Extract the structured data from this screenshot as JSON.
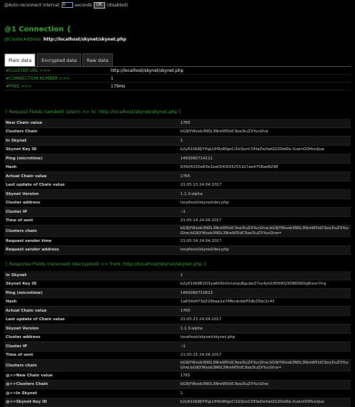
{
  "top": {
    "label": "@Auto-reconnect interval:",
    "interval_value": "0",
    "seconds": "seconds",
    "ok": "OK",
    "status": "(disabled)"
  },
  "connection": {
    "title": "@1 Connection {",
    "address_label": "@ClusterAddress:",
    "address": "http://localhost/skynet/skynet.php"
  },
  "tabs": [
    "Plain data",
    "Encrypted data",
    "Raw data"
  ],
  "summary": [
    {
      "k": "#CLUSTER URL >>>",
      "v": "http://localhost/skynet/skynet.php"
    },
    {
      "k": "#CONNECTION NUMBER >>>",
      "v": "1"
    },
    {
      "k": "#PING >>>",
      "v": "179ms"
    }
  ],
  "request": {
    "heading": "[ Request Fields (sended) (plain) >> to: http://localhost/skynet/skynet.php ]",
    "rows": [
      {
        "k": "New Chain value",
        "v": "1765"
      },
      {
        "k": "Clusters Chain",
        "v": "bG9jYWxob3N0L3NreW5ldC9za3luZXYucGhw"
      },
      {
        "k": "In Skynet",
        "v": "1"
      },
      {
        "k": "Skynet Key ID",
        "v": "b2y610b8JIYHgLUH0oRfgoCl1kQunCOHaZwXwGG2De6le.XuwnOOHunljua"
      },
      {
        "k": "Ping (microtime)",
        "v": "1493060714111"
      },
      {
        "k": "Hash",
        "v": "83904150a83e1ba0543f242551b7ae4758ae8298"
      },
      {
        "k": "Actual Chain value",
        "v": "1765"
      },
      {
        "k": "Last update of Chain value",
        "v": "21:05:13 24.04.2017"
      },
      {
        "k": "Skynet Version",
        "v": "1.1.3-alpha"
      },
      {
        "k": "Cluster address",
        "v": "localhost/skynet/dev.php"
      },
      {
        "k": "Cluster IP",
        "v": "::1"
      },
      {
        "k": "Time of sent",
        "v": "21:05:14 24.04.2017"
      },
      {
        "k": "Clusters chain",
        "v": "bG9jYWxob3N0L3NreW5ldC9za3luZXYucGhw;bG9jYWxob3N0L3NreW5ldC9za3luZXYucGhw;bG9jYWxob3N0L3NreW5ldC9za3luZXYucGhw=",
        "tall": true
      },
      {
        "k": "Request sender time",
        "v": "21:05:14 24.04.2017"
      },
      {
        "k": "Request sender address",
        "v": "localhost/skynet/dev.php"
      }
    ]
  },
  "response": {
    "heading": "[ Response Fields (received) (decrypted) << from: http://localhost/skynet/skynet.php ]",
    "rows": [
      {
        "k": "In Skynet",
        "v": "1"
      },
      {
        "k": "Skynet Key ID",
        "v": "b2y610b8E2O3yaKhfGUh/umJuBgubeZ7sy4yGUfDf/RQ3D8656Dq8rxsn7nq"
      },
      {
        "k": "Ping (microtime)",
        "v": "1493060715813"
      },
      {
        "k": "Hash",
        "v": "1a834d473d229baa1a74fbcdcbbff3db25bc2c42"
      },
      {
        "k": "Actual Chain value",
        "v": "1765"
      },
      {
        "k": "Last update of Chain value",
        "v": "21:05:13 24.04.2017"
      },
      {
        "k": "Skynet Version",
        "v": "1.1.3-alpha"
      },
      {
        "k": "Cluster address",
        "v": "localhost/skynet/skynet.php"
      },
      {
        "k": "Cluster IP",
        "v": "::1"
      },
      {
        "k": "Time of sent",
        "v": "21:05:15 24.04.2017"
      },
      {
        "k": "Clusters chain",
        "v": "bG9jYWxob3N0L3NreW5ldC9za3luZXYucGhw;bG9jYWxob3N0L3NreW5ldC9za3luZXYucGhw;bG9jYWxob3N0L3NreW5ldC9za3luZXYucGhw=",
        "tall": true
      },
      {
        "k": "@>>New Chain value",
        "v": "1765"
      },
      {
        "k": "@>>Clusters Chain",
        "v": "bG9jYWxob3N0L3NreW5ldC9za3luZXYucGhw"
      },
      {
        "k": "@>>In Skynet",
        "v": "1"
      },
      {
        "k": "@>>Skynet Key ID",
        "v": "b2y610b8JIYHgLUH0oRfgoCl1kQunCOHaZwXwGG2De6le.XuwnOOHunljua"
      }
    ]
  }
}
